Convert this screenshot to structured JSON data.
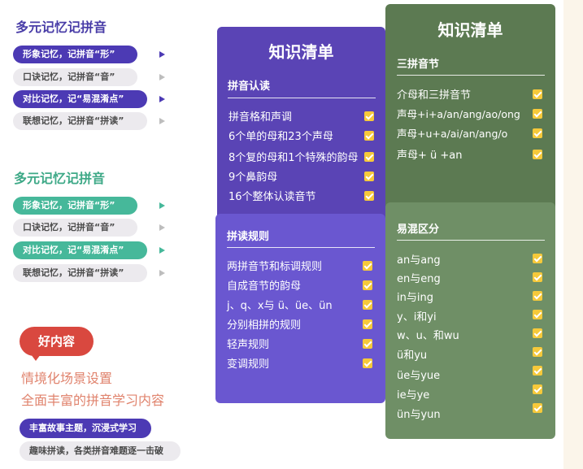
{
  "left": {
    "group1": {
      "title": "多元记忆记拼音",
      "items": [
        "形象记忆，记拼音“形”",
        "口诀记忆，记拼音“音”",
        "对比记忆，记“易混淆点”",
        "联想记忆，记拼音“拼读”"
      ]
    },
    "group2": {
      "title": "多元记忆记拼音",
      "items": [
        "形象记忆，记拼音“形”",
        "口诀记忆，记拼音“音”",
        "对比记忆，记“易混淆点”",
        "联想记忆，记拼音“拼读”"
      ]
    },
    "badge": "好内容",
    "red_lines": [
      "情境化场景设置",
      "全面丰富的拼音学习内容"
    ],
    "bottom_pills": [
      "丰富故事主题，沉浸式学习",
      "趣味拼读，各类拼音难题逐一击破"
    ]
  },
  "purple_panel": {
    "title": "知识清单",
    "sections": [
      {
        "heading": "拼音认读",
        "items": [
          "拼音格和声调",
          "6个单的母和23个声母",
          "8个复的母和1个特殊的韵母",
          "9个鼻韵母",
          "16个整体认读音节"
        ]
      },
      {
        "heading": "拼读规则",
        "items": [
          "两拼音节和标调规则",
          "自成音节的韵母",
          "j、q、x与 ü、üe、ün",
          "分别相拼的规则",
          "轻声规则",
          "变调规则"
        ]
      }
    ]
  },
  "green_panel": {
    "title": "知识清单",
    "sections": [
      {
        "heading": "三拼音节",
        "items": [
          "介母和三拼音节",
          "声母+i+a/an/ang/ao/ong",
          "声母+u+a/ai/an/ang/o",
          "声母+ ü +an"
        ]
      },
      {
        "heading": "易混区分",
        "items": [
          "an与ang",
          "en与eng",
          "in与ing",
          "y、i和yi",
          "w、u、和wu",
          "ü和yu",
          "üe与yue",
          "ie与ye",
          "ün与yun"
        ]
      }
    ]
  },
  "colors": {
    "purple_dark": "#5a44b5",
    "purple_light": "#6a57d0",
    "green_dark": "#5c7a52",
    "green_light": "#6f8f66",
    "teal": "#46b89a",
    "check_yellow": "#f6c93a",
    "badge_red": "#d9483f"
  }
}
